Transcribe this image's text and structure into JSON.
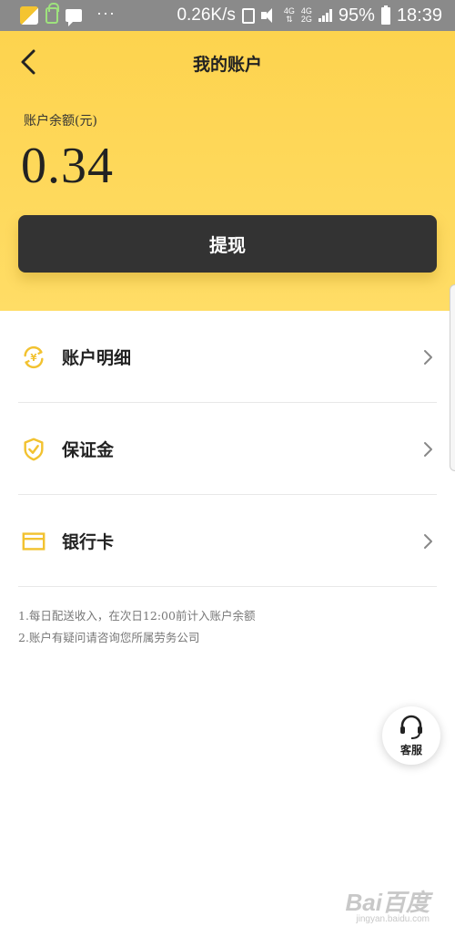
{
  "status_bar": {
    "speed": "0.26K/s",
    "net_top": "4G",
    "net_mid_top": "4G",
    "net_mid_bottom": "2G",
    "battery": "95%",
    "time": "18:39",
    "dots": "···"
  },
  "header": {
    "title": "我的账户",
    "balance_label": "账户余额(元)",
    "balance_value": "0.34",
    "withdraw_label": "提现",
    "accent_color": "#fdd34e"
  },
  "menu": {
    "items": [
      {
        "label": "账户明细",
        "icon": "yuan-refresh-icon"
      },
      {
        "label": "保证金",
        "icon": "shield-check-icon"
      },
      {
        "label": "银行卡",
        "icon": "card-icon"
      }
    ]
  },
  "notes": [
    "1.每日配送收入，在次日12:00前计入账户余额",
    "2.账户有疑问请咨询您所属劳务公司"
  ],
  "service": {
    "label": "客服",
    "icon": "headset-icon"
  },
  "watermark": {
    "brand": "Bai百度",
    "domain": "jingyan.baidu.com"
  }
}
